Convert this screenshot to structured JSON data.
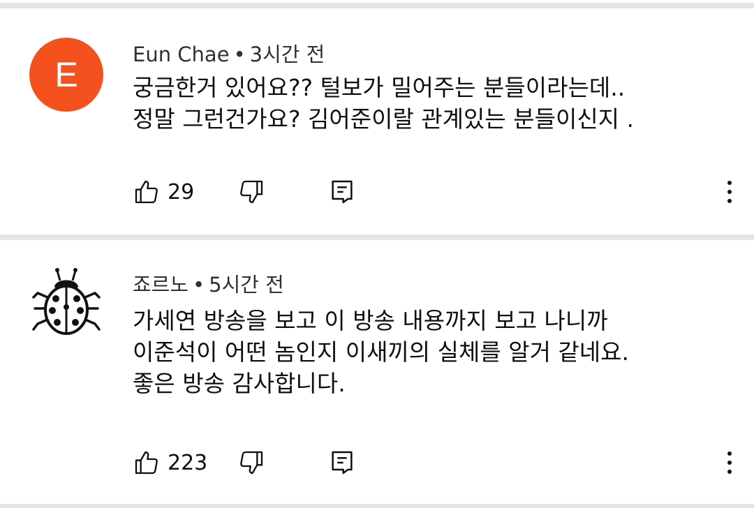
{
  "comments": [
    {
      "avatar_letter": "E",
      "avatar_color": "#f4511e",
      "author": "Eun Chae",
      "separator": "•",
      "time": "3시간 전",
      "lines": [
        "궁금한거 있어요?? 털보가 밀어주는 분들이라는데..",
        "정말 그런건가요? 김어준이랄 관계있는 분들이신지 ."
      ],
      "likes": "29"
    },
    {
      "avatar_icon": "ladybug-icon",
      "author": "죠르노",
      "separator": "•",
      "time": "5시간 전",
      "lines": [
        "가세연 방송을 보고 이 방송 내용까지 보고 나니까",
        "이준석이 어떤 놈인지 이새끼의 실체를 알거 같네요.",
        "좋은 방송 감사합니다."
      ],
      "likes": "223"
    }
  ],
  "icons": {
    "like": "thumbs-up-icon",
    "dislike": "thumbs-down-icon",
    "reply": "reply-icon",
    "more": "more-vertical-icon"
  },
  "colors": {
    "divider": "#e5e5e5",
    "text": "#0f0f0f",
    "meta": "#303030"
  }
}
